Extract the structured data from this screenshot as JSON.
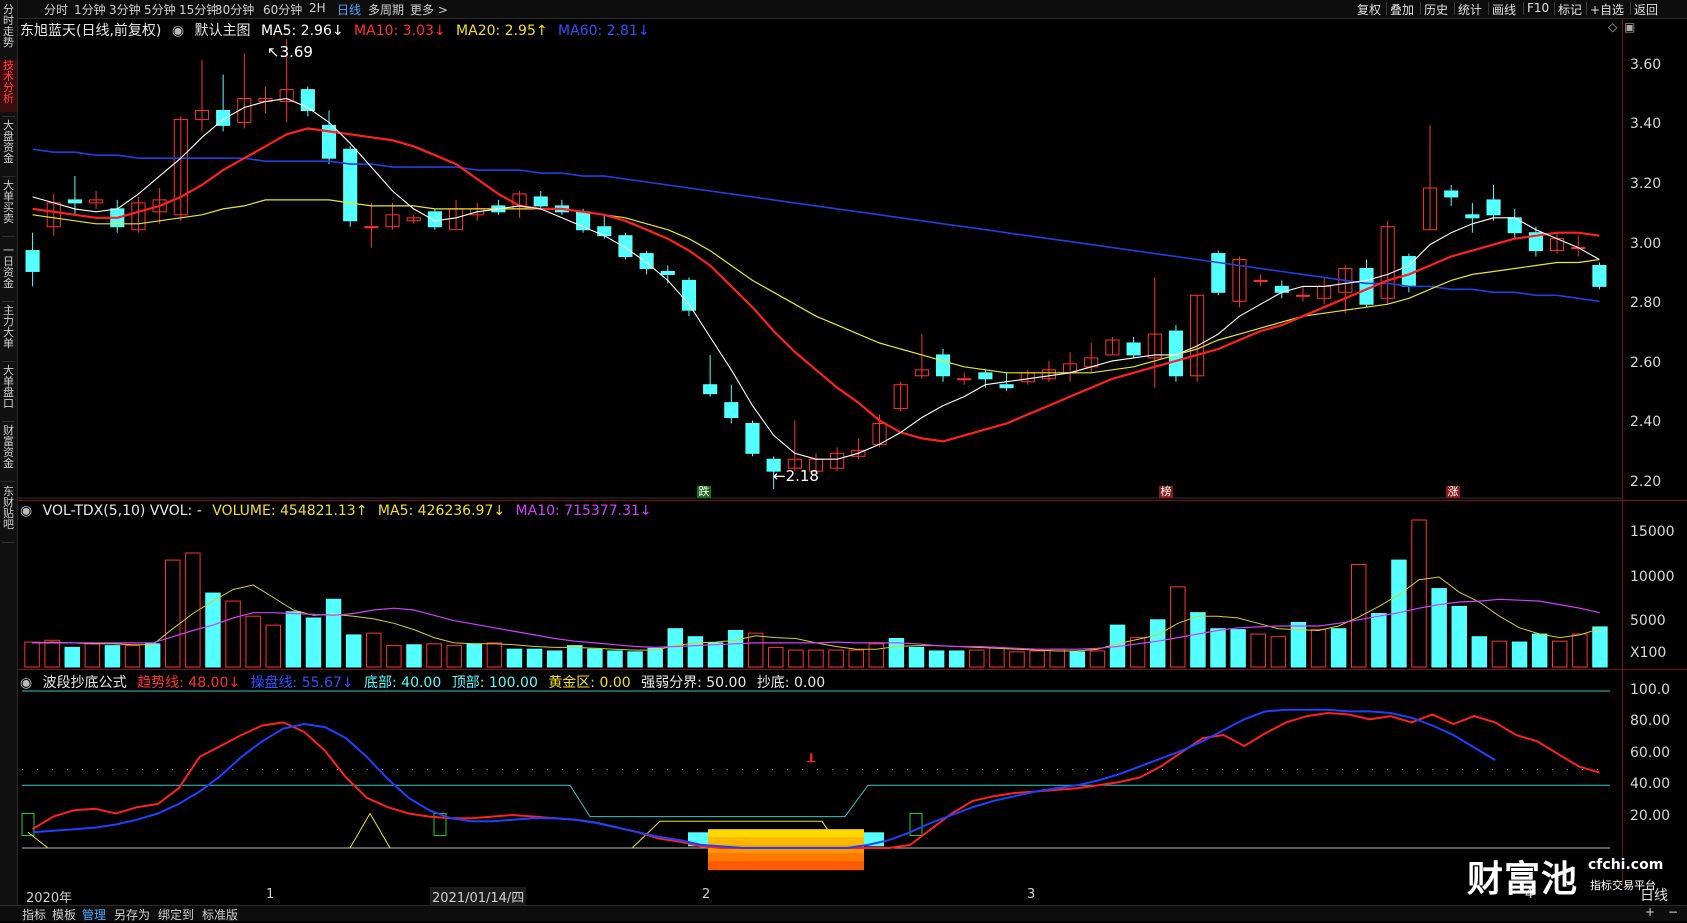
{
  "period_tabs": [
    "分时",
    "1分钟",
    "3分钟",
    "5分钟",
    "15分钟",
    "30分钟",
    "60分钟",
    "2H",
    "日线",
    "多周期",
    "更多 >"
  ],
  "active_period": "日线",
  "right_tools": [
    "复权",
    "叠加",
    "历史",
    "统计",
    "画线",
    "F10",
    "标记",
    "+自选",
    "返回"
  ],
  "sidebar_items": [
    "分时走势",
    "技术分析",
    "大盘资金",
    "大单买卖",
    "一日资金",
    "主力大单",
    "大单盘口",
    "财富资金",
    "东财贴吧"
  ],
  "main_legend": {
    "title": "东旭蓝天(日线,前复权)",
    "template": "默认主图",
    "ma5": "MA5: 2.96↓",
    "ma10": "MA10: 3.03↓",
    "ma20": "MA20: 2.95↑",
    "ma60": "MA60: 2.81↓"
  },
  "price_annotations": {
    "high": "3.69",
    "low": "2.18"
  },
  "markers": [
    "跌",
    "榜",
    "涨"
  ],
  "vol_legend": {
    "title": "VOL-TDX(5,10) VVOL: -",
    "volume": "VOLUME: 454821.13↑",
    "ma5": "MA5: 426236.97↓",
    "ma10": "MA10: 715377.31↓"
  },
  "osc_legend": {
    "title": "波段抄底公式",
    "trend": "趋势线: 48.00↓",
    "control": "操盘线: 55.67↓",
    "bottom": "底部: 40.00",
    "top": "顶部: 100.00",
    "gold": "黄金区: 0.00",
    "strongweak": "强弱分界: 50.00",
    "copy_bottom": "抄底: 0.00"
  },
  "price_axis": [
    "3.60",
    "3.40",
    "3.20",
    "3.00",
    "2.80",
    "2.60",
    "2.40",
    "2.20"
  ],
  "vol_axis": [
    "15000",
    "10000",
    "5000",
    "X100"
  ],
  "osc_axis": [
    "100.0",
    "80.00",
    "60.00",
    "40.00",
    "20.00"
  ],
  "x_axis": [
    "2020年",
    "1",
    "2021/01/14/四",
    "2",
    "3",
    "4"
  ],
  "bottom_tabs": [
    "指标",
    "模板",
    "管理",
    "另存为",
    "绑定到",
    "标准版"
  ],
  "active_bottom_tab": "管理",
  "watermark": {
    "brand": "财富池",
    "domain": "cfchi.com",
    "tagline": "指标交易平台"
  },
  "corner_label": "日线",
  "colors": {
    "up": "#ff3232",
    "down": "#54ffff",
    "ma5": "#ffffff",
    "ma10": "#ff2020",
    "ma20": "#e8e820",
    "ma60": "#2040e0",
    "vol_ma10": "#d040ff",
    "trend": "#ff2020",
    "control": "#2040ff"
  },
  "chart_data": [
    {
      "type": "candlestick",
      "title": "东旭蓝天(日线,前复权)",
      "ylim": [
        2.15,
        3.72
      ],
      "candles": [
        [
          2.98,
          2.91,
          3.04,
          2.86
        ],
        [
          3.06,
          3.14,
          3.17,
          3.03
        ],
        [
          3.15,
          3.14,
          3.23,
          3.1
        ],
        [
          3.14,
          3.15,
          3.18,
          3.12
        ],
        [
          3.12,
          3.06,
          3.15,
          3.04
        ],
        [
          3.05,
          3.14,
          3.16,
          3.04
        ],
        [
          3.11,
          3.15,
          3.19,
          3.07
        ],
        [
          3.1,
          3.42,
          3.43,
          3.08
        ],
        [
          3.42,
          3.45,
          3.62,
          3.38
        ],
        [
          3.45,
          3.4,
          3.57,
          3.38
        ],
        [
          3.41,
          3.49,
          3.64,
          3.39
        ],
        [
          3.48,
          3.49,
          3.53,
          3.44
        ],
        [
          3.48,
          3.52,
          3.69,
          3.41
        ],
        [
          3.52,
          3.45,
          3.53,
          3.43
        ],
        [
          3.4,
          3.29,
          3.45,
          3.27
        ],
        [
          3.32,
          3.08,
          3.33,
          3.06
        ],
        [
          3.06,
          3.06,
          3.14,
          2.99
        ],
        [
          3.06,
          3.1,
          3.14,
          3.05
        ],
        [
          3.08,
          3.09,
          3.1,
          3.07
        ],
        [
          3.11,
          3.06,
          3.12,
          3.05
        ],
        [
          3.05,
          3.12,
          3.15,
          3.05
        ],
        [
          3.1,
          3.12,
          3.14,
          3.08
        ],
        [
          3.13,
          3.11,
          3.15,
          3.1
        ],
        [
          3.12,
          3.17,
          3.18,
          3.09
        ],
        [
          3.16,
          3.13,
          3.18,
          3.12
        ],
        [
          3.13,
          3.11,
          3.15,
          3.1
        ],
        [
          3.11,
          3.05,
          3.12,
          3.04
        ],
        [
          3.06,
          3.03,
          3.1,
          3.02
        ],
        [
          3.03,
          2.96,
          3.04,
          2.95
        ],
        [
          2.97,
          2.92,
          2.98,
          2.9
        ],
        [
          2.91,
          2.9,
          2.93,
          2.87
        ],
        [
          2.88,
          2.78,
          2.89,
          2.76
        ],
        [
          2.53,
          2.5,
          2.63,
          2.49
        ],
        [
          2.47,
          2.42,
          2.53,
          2.4
        ],
        [
          2.4,
          2.3,
          2.41,
          2.29
        ],
        [
          2.28,
          2.24,
          2.29,
          2.18
        ],
        [
          2.25,
          2.28,
          2.41,
          2.24
        ],
        [
          2.24,
          2.28,
          2.3,
          2.23
        ],
        [
          2.25,
          2.3,
          2.32,
          2.24
        ],
        [
          2.29,
          2.31,
          2.35,
          2.28
        ],
        [
          2.33,
          2.4,
          2.43,
          2.32
        ],
        [
          2.45,
          2.53,
          2.54,
          2.44
        ],
        [
          2.56,
          2.58,
          2.7,
          2.55
        ],
        [
          2.63,
          2.56,
          2.65,
          2.54
        ],
        [
          2.55,
          2.55,
          2.57,
          2.53
        ],
        [
          2.57,
          2.55,
          2.58,
          2.52
        ],
        [
          2.53,
          2.52,
          2.57,
          2.51
        ],
        [
          2.54,
          2.57,
          2.58,
          2.53
        ],
        [
          2.55,
          2.58,
          2.61,
          2.54
        ],
        [
          2.57,
          2.6,
          2.64,
          2.54
        ],
        [
          2.59,
          2.62,
          2.67,
          2.57
        ],
        [
          2.63,
          2.68,
          2.69,
          2.63
        ],
        [
          2.67,
          2.63,
          2.69,
          2.62
        ],
        [
          2.62,
          2.7,
          2.89,
          2.52
        ],
        [
          2.71,
          2.56,
          2.73,
          2.54
        ],
        [
          2.56,
          2.83,
          2.83,
          2.54
        ],
        [
          2.97,
          2.84,
          2.98,
          2.83
        ],
        [
          2.81,
          2.95,
          2.96,
          2.79
        ],
        [
          2.88,
          2.88,
          2.9,
          2.86
        ],
        [
          2.86,
          2.84,
          2.88,
          2.82
        ],
        [
          2.83,
          2.83,
          2.86,
          2.81
        ],
        [
          2.82,
          2.86,
          2.89,
          2.8
        ],
        [
          2.84,
          2.92,
          2.93,
          2.77
        ],
        [
          2.92,
          2.8,
          2.95,
          2.79
        ],
        [
          2.82,
          3.06,
          3.08,
          2.8
        ],
        [
          2.96,
          2.86,
          2.97,
          2.84
        ],
        [
          3.05,
          3.19,
          3.4,
          3.05
        ],
        [
          3.18,
          3.16,
          3.2,
          3.13
        ],
        [
          3.1,
          3.09,
          3.14,
          3.04
        ],
        [
          3.15,
          3.1,
          3.2,
          3.08
        ],
        [
          3.09,
          3.04,
          3.12,
          3.02
        ],
        [
          3.04,
          2.98,
          3.06,
          2.96
        ],
        [
          2.98,
          3.02,
          3.04,
          2.97
        ],
        [
          2.99,
          2.99,
          3.03,
          2.96
        ],
        [
          2.93,
          2.86,
          2.94,
          2.85
        ]
      ],
      "ma5": [
        3.16,
        3.14,
        3.12,
        3.11,
        3.12,
        3.17,
        3.23,
        3.29,
        3.36,
        3.42,
        3.46,
        3.48,
        3.49,
        3.46,
        3.41,
        3.34,
        3.26,
        3.18,
        3.12,
        3.08,
        3.09,
        3.11,
        3.12,
        3.13,
        3.12,
        3.09,
        3.06,
        3.03,
        2.99,
        2.94,
        2.88,
        2.8,
        2.69,
        2.58,
        2.46,
        2.36,
        2.3,
        2.28,
        2.28,
        2.3,
        2.33,
        2.37,
        2.42,
        2.46,
        2.49,
        2.53,
        2.54,
        2.55,
        2.56,
        2.57,
        2.59,
        2.61,
        2.62,
        2.63,
        2.63,
        2.66,
        2.7,
        2.76,
        2.8,
        2.84,
        2.86,
        2.86,
        2.87,
        2.88,
        2.9,
        2.93,
        3.0,
        3.04,
        3.07,
        3.09,
        3.09,
        3.05,
        3.02,
        2.99,
        2.95
      ],
      "ma10": [
        3.12,
        3.11,
        3.1,
        3.09,
        3.09,
        3.11,
        3.13,
        3.16,
        3.2,
        3.25,
        3.29,
        3.33,
        3.37,
        3.39,
        3.38,
        3.37,
        3.36,
        3.35,
        3.33,
        3.3,
        3.27,
        3.22,
        3.17,
        3.13,
        3.12,
        3.12,
        3.11,
        3.1,
        3.08,
        3.05,
        3.02,
        2.98,
        2.93,
        2.86,
        2.79,
        2.71,
        2.64,
        2.58,
        2.52,
        2.47,
        2.41,
        2.37,
        2.35,
        2.34,
        2.36,
        2.38,
        2.4,
        2.43,
        2.46,
        2.49,
        2.52,
        2.55,
        2.57,
        2.59,
        2.61,
        2.63,
        2.65,
        2.68,
        2.71,
        2.73,
        2.76,
        2.79,
        2.82,
        2.85,
        2.88,
        2.9,
        2.93,
        2.96,
        2.98,
        3.0,
        3.02,
        3.03,
        3.04,
        3.04,
        3.03
      ],
      "ma20": [
        3.1,
        3.09,
        3.08,
        3.07,
        3.07,
        3.07,
        3.08,
        3.09,
        3.1,
        3.12,
        3.13,
        3.15,
        3.15,
        3.15,
        3.15,
        3.14,
        3.13,
        3.13,
        3.13,
        3.12,
        3.12,
        3.12,
        3.12,
        3.12,
        3.12,
        3.12,
        3.11,
        3.1,
        3.09,
        3.07,
        3.05,
        3.02,
        2.98,
        2.93,
        2.88,
        2.84,
        2.8,
        2.76,
        2.73,
        2.7,
        2.67,
        2.65,
        2.63,
        2.61,
        2.59,
        2.58,
        2.57,
        2.57,
        2.57,
        2.57,
        2.57,
        2.58,
        2.59,
        2.61,
        2.63,
        2.65,
        2.68,
        2.7,
        2.72,
        2.74,
        2.76,
        2.77,
        2.78,
        2.79,
        2.8,
        2.82,
        2.85,
        2.88,
        2.9,
        2.91,
        2.92,
        2.93,
        2.94,
        2.94,
        2.95
      ],
      "ma60": [
        3.32,
        3.31,
        3.31,
        3.3,
        3.3,
        3.29,
        3.29,
        3.29,
        3.29,
        3.29,
        3.29,
        3.28,
        3.28,
        3.28,
        3.28,
        3.27,
        3.27,
        3.26,
        3.26,
        3.26,
        3.26,
        3.25,
        3.25,
        3.25,
        3.24,
        3.24,
        3.23,
        3.23,
        3.22,
        3.21,
        3.2,
        3.19,
        3.18,
        3.17,
        3.16,
        3.15,
        3.14,
        3.13,
        3.12,
        3.11,
        3.1,
        3.09,
        3.08,
        3.07,
        3.06,
        3.05,
        3.04,
        3.03,
        3.02,
        3.01,
        3.0,
        2.99,
        2.98,
        2.97,
        2.96,
        2.95,
        2.94,
        2.93,
        2.92,
        2.91,
        2.9,
        2.89,
        2.88,
        2.87,
        2.87,
        2.86,
        2.86,
        2.85,
        2.85,
        2.84,
        2.84,
        2.83,
        2.83,
        2.82,
        2.81
      ]
    },
    {
      "type": "bar",
      "title": "VOL-TDX(5,10)",
      "ylim": [
        0,
        16500
      ],
      "unit": "X100",
      "volume": [
        2800,
        3000,
        2200,
        2600,
        2400,
        2400,
        2600,
        12000,
        12800,
        8300,
        7400,
        5700,
        4700,
        6200,
        5500,
        7600,
        3600,
        3800,
        2400,
        2500,
        2600,
        2400,
        2600,
        2700,
        2000,
        2000,
        1800,
        2400,
        2000,
        1800,
        1700,
        2100,
        4300,
        3400,
        2700,
        4100,
        3800,
        2200,
        1900,
        1900,
        1900,
        1900,
        2600,
        3200,
        2200,
        1800,
        1800,
        1900,
        2200,
        1700,
        1800,
        2000,
        1700,
        1800,
        4700,
        3300,
        5300,
        9000,
        6100,
        4300,
        4200,
        3700,
        3400,
        5000,
        4200,
        4300,
        11500,
        6000,
        12000,
        16500,
        8800,
        6800,
        3400,
        2900,
        2800,
        3700,
        2900,
        3700,
        4500
      ],
      "up": [
        true,
        true,
        false,
        true,
        false,
        true,
        false,
        true,
        true,
        false,
        true,
        true,
        true,
        false,
        false,
        false,
        false,
        true,
        true,
        false,
        true,
        true,
        false,
        true,
        false,
        false,
        false,
        false,
        false,
        false,
        false,
        false,
        false,
        false,
        false,
        false,
        true,
        true,
        true,
        true,
        true,
        true,
        true,
        false,
        false,
        false,
        false,
        true,
        true,
        true,
        true,
        true,
        false,
        true,
        false,
        true,
        false,
        true,
        false,
        false,
        false,
        true,
        true,
        false,
        true,
        false,
        true,
        false,
        false,
        true,
        false,
        false,
        false,
        true,
        false,
        false
      ],
      "ma5": [
        2700,
        2800,
        2700,
        2600,
        2600,
        2500,
        2500,
        4300,
        6000,
        7400,
        8700,
        9200,
        7800,
        6400,
        5800,
        5900,
        5700,
        5400,
        4900,
        4200,
        3300,
        2700,
        2600,
        2600,
        2500,
        2300,
        2200,
        2200,
        2100,
        2000,
        1900,
        1900,
        2400,
        2700,
        2800,
        3000,
        3500,
        3300,
        3200,
        2700,
        2300,
        2000,
        2000,
        2300,
        2400,
        2400,
        2300,
        2200,
        2100,
        2000,
        1900,
        1800,
        1800,
        2000,
        2600,
        3100,
        3600,
        4900,
        5700,
        5700,
        5500,
        4900,
        4300,
        4200,
        4100,
        4600,
        5600,
        6800,
        8100,
        9800,
        10100,
        8400,
        7300,
        5700,
        4400,
        3700,
        3300,
        3600,
        4300
      ],
      "ma10": [
        2700,
        2700,
        2700,
        2700,
        2700,
        2700,
        2700,
        3400,
        4100,
        4700,
        5500,
        6100,
        6100,
        6000,
        5900,
        5800,
        6000,
        6400,
        6600,
        6400,
        5800,
        5200,
        4800,
        4400,
        4000,
        3600,
        3200,
        2900,
        2700,
        2500,
        2300,
        2200,
        2300,
        2400,
        2500,
        2600,
        2700,
        2700,
        2700,
        2700,
        2800,
        2700,
        2700,
        2700,
        2600,
        2400,
        2300,
        2300,
        2200,
        2100,
        2000,
        2000,
        2000,
        2100,
        2300,
        2600,
        2900,
        3300,
        3700,
        4100,
        4400,
        4500,
        4600,
        4600,
        4600,
        4900,
        5300,
        5700,
        6100,
        6600,
        7000,
        7300,
        7400,
        7600,
        7500,
        7400,
        7000,
        6600,
        6100
      ]
    },
    {
      "type": "line",
      "title": "波段抄底公式",
      "ylim": [
        0,
        100
      ],
      "trend": [
        12,
        20,
        24,
        25,
        22,
        26,
        28,
        38,
        58,
        65,
        72,
        78,
        80,
        74,
        62,
        45,
        32,
        26,
        22,
        20,
        19,
        19,
        20,
        21,
        20,
        19,
        18,
        16,
        13,
        10,
        6,
        4,
        1,
        0,
        0,
        0,
        0,
        0,
        0,
        0,
        0,
        0,
        2,
        12,
        22,
        30,
        33,
        35,
        36,
        37,
        38,
        40,
        42,
        45,
        52,
        61,
        70,
        72,
        65,
        73,
        80,
        84,
        86,
        85,
        82,
        84,
        80,
        85,
        79,
        84,
        80,
        72,
        68,
        60,
        52,
        48
      ],
      "control": [
        10,
        11,
        12,
        13,
        15,
        18,
        22,
        28,
        36,
        46,
        58,
        68,
        76,
        79,
        77,
        70,
        58,
        44,
        32,
        24,
        19,
        17,
        17,
        18,
        19,
        19,
        18,
        16,
        13,
        10,
        7,
        5,
        2,
        1,
        0,
        0,
        0,
        0,
        0,
        0,
        2,
        5,
        10,
        16,
        21,
        26,
        30,
        33,
        36,
        38,
        40,
        43,
        47,
        52,
        57,
        62,
        68,
        75,
        82,
        87,
        88,
        88,
        88,
        87,
        87,
        86,
        83,
        78,
        72,
        64,
        56
      ]
    }
  ]
}
